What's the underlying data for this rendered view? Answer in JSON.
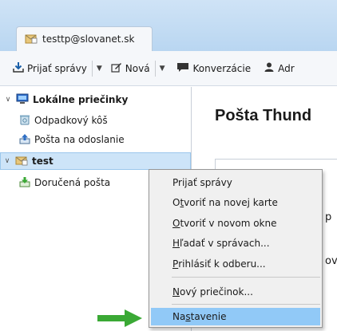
{
  "tab": {
    "title": "testtp@slovanet.sk",
    "icon": "mail-folder-icon"
  },
  "toolbar": {
    "get_messages": "Prijať správy",
    "new": "Nová",
    "chat": "Konverzácie",
    "address": "Adr"
  },
  "folders": [
    {
      "label": "Lokálne priečinky",
      "icon": "local-folders-icon",
      "bold": true,
      "expanded": true
    },
    {
      "label": "Odpadkový kôš",
      "icon": "trash-icon"
    },
    {
      "label": "Pošta na odoslanie",
      "icon": "outbox-icon"
    },
    {
      "label": "test",
      "icon": "account-icon",
      "bold": true,
      "expanded": true,
      "selected": true
    },
    {
      "label": "Doručená pošta",
      "icon": "inbox-icon"
    }
  ],
  "content": {
    "title": "Pošta Thund",
    "frag1": "p",
    "frag2": "ov"
  },
  "context_menu": {
    "items": [
      {
        "pre": "Prijať správy",
        "key": "",
        "post": ""
      },
      {
        "pre": "O",
        "key": "t",
        "post": "voriť na novej karte"
      },
      {
        "pre": "",
        "key": "O",
        "post": "tvoriť v novom okne"
      },
      {
        "pre": "",
        "key": "H",
        "post": "ľadať v správach..."
      },
      {
        "pre": "",
        "key": "P",
        "post": "rihlásiť k odberu..."
      },
      {
        "pre": "",
        "key": "N",
        "post": "ový priečinok..."
      },
      {
        "pre": "Na",
        "key": "s",
        "post": "tavenie"
      }
    ],
    "highlighted_index": 6
  },
  "colors": {
    "highlight": "#91c9f7",
    "arrow": "#3aa935",
    "selection": "#cde4f8"
  }
}
